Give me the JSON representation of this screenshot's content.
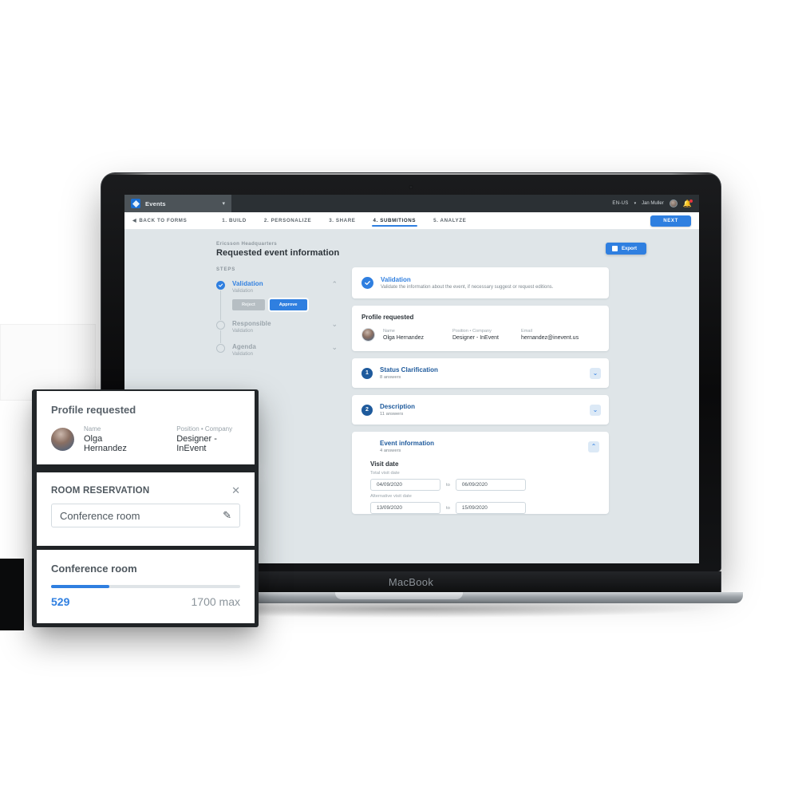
{
  "device": {
    "label": "MacBook"
  },
  "topbar": {
    "app_name": "Events",
    "logo_icon": "events-logo-icon",
    "caret_icon": "chevron-down-icon",
    "language": "EN-US",
    "lang_caret_icon": "chevron-down-icon",
    "user_name": "Jan Muller",
    "avatar_icon": "user-avatar",
    "bell_icon": "notification-bell-icon",
    "bell_badge": ""
  },
  "navbar": {
    "back_label": "BACK TO FORMS",
    "back_icon": "chevron-left-icon",
    "steps": [
      {
        "label": "1. BUILD",
        "active": false
      },
      {
        "label": "2. PERSONALIZE",
        "active": false
      },
      {
        "label": "3. SHARE",
        "active": false
      },
      {
        "label": "4. SUBMITIONS",
        "active": true
      },
      {
        "label": "5. ANALYZE",
        "active": false
      }
    ],
    "next_label": "NEXT"
  },
  "page": {
    "eyebrow": "Ericsson Headquarters",
    "title": "Requested event information",
    "export_label": "Export",
    "export_icon": "export-icon"
  },
  "steps_panel": {
    "label": "STEPS",
    "items": [
      {
        "name": "Validation",
        "sub": "Validation",
        "state": "done",
        "chevron_icon": "chevron-up-icon",
        "reject_label": "Reject",
        "approve_label": "Approve"
      },
      {
        "name": "Responsible",
        "sub": "Validation",
        "state": "pending",
        "chevron_icon": "chevron-down-icon"
      },
      {
        "name": "Agenda",
        "sub": "Validation",
        "state": "pending",
        "chevron_icon": "chevron-down-icon"
      }
    ]
  },
  "validation_card": {
    "icon": "check-circle-icon",
    "title": "Validation",
    "description": "Validate the information about the event, if necessary suggest or request editions."
  },
  "profile_card": {
    "title": "Profile requested",
    "avatar_icon": "user-avatar",
    "fields": [
      {
        "label": "Name",
        "value": "Olga Hernandez"
      },
      {
        "label": "Position • Company",
        "value": "Designer - InEvent"
      },
      {
        "label": "Email",
        "value": "hernandez@inevent.us"
      }
    ]
  },
  "sections": [
    {
      "number": "1",
      "title": "Status Clarification",
      "answers": "8 answers",
      "expanded": false,
      "chevron_icon": "chevron-down-icon"
    },
    {
      "number": "2",
      "title": "Description",
      "answers": "11 answers",
      "expanded": false,
      "chevron_icon": "chevron-down-icon"
    },
    {
      "number": "",
      "title": "Event information",
      "answers": "4 answers",
      "expanded": true,
      "chevron_icon": "chevron-up-icon"
    }
  ],
  "event_information": {
    "heading": "Visit date",
    "total_label": "Total visit date",
    "total_from": "04/09/2020",
    "total_to": "06/09/2020",
    "alt_label": "Alternative visit date",
    "alt_from": "13/09/2020",
    "alt_to": "15/09/2020",
    "to_word": "to"
  },
  "overlay_profile": {
    "title": "Profile requested",
    "avatar_icon": "user-avatar",
    "fields": [
      {
        "label": "Name",
        "value": "Olga Hernandez"
      },
      {
        "label": "Position • Company",
        "value": "Designer - InEvent"
      }
    ]
  },
  "overlay_room": {
    "title": "ROOM RESERVATION",
    "close_icon": "close-icon",
    "input_value": "Conference room",
    "edit_icon": "pencil-icon"
  },
  "overlay_capacity": {
    "title": "Conference room",
    "current": "529",
    "max": "1700 max",
    "percent": 31
  },
  "colors": {
    "accent": "#2f7fe0",
    "dark_navy": "#1e5a9c",
    "topbar": "#2b3034",
    "canvas": "#dfe5e8",
    "muted": "#9aa4ab",
    "danger": "#e8343c"
  }
}
